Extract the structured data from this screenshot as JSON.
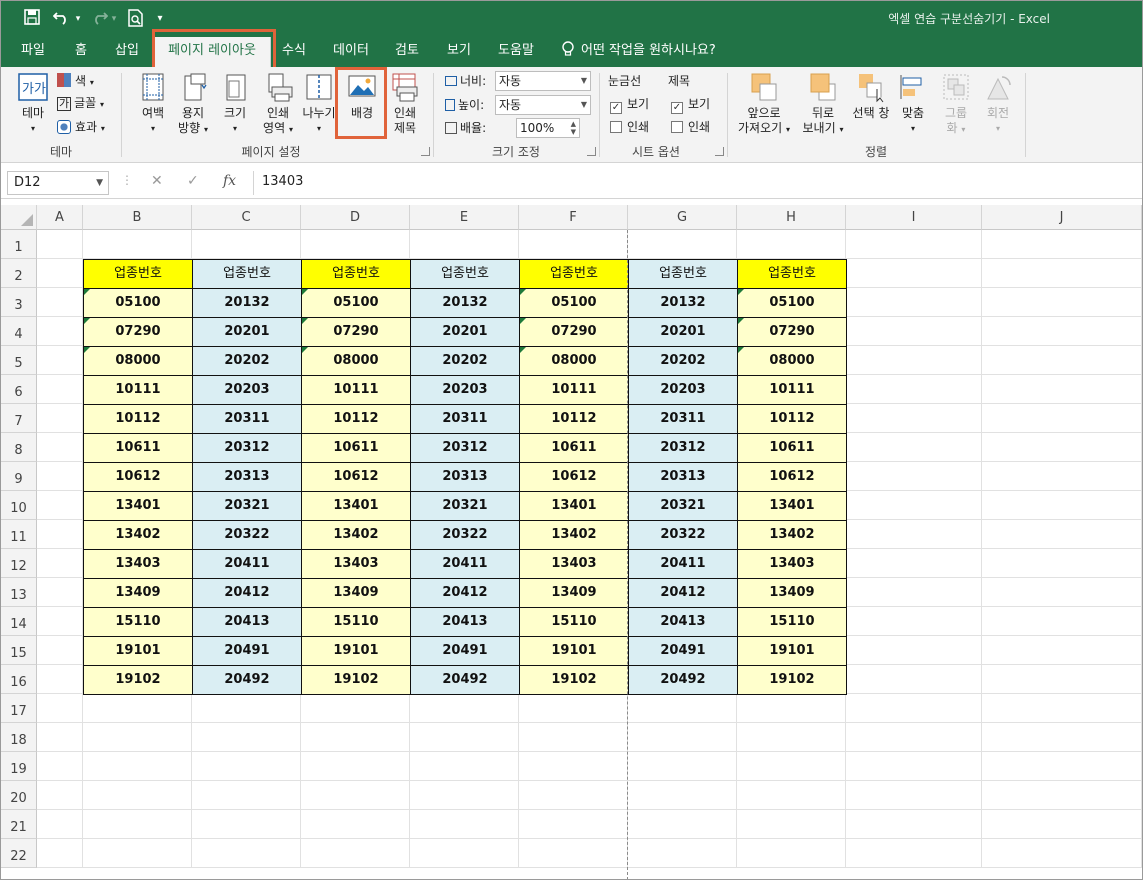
{
  "window": {
    "title": "엑셀 연습 구분선숨기기  -  Excel"
  },
  "tabs": [
    "파일",
    "홈",
    "삽입",
    "페이지 레이아웃",
    "수식",
    "데이터",
    "검토",
    "보기",
    "도움말"
  ],
  "tell_me": "어떤 작업을 원하시나요?",
  "ribbon": {
    "theme": {
      "theme_btn": "테마",
      "color": "색",
      "font": "글꼴",
      "effect": "효과",
      "group": "테마"
    },
    "page_setup": {
      "margins": "여백",
      "orientation_1": "용지",
      "orientation_2": "방향",
      "size": "크기",
      "print_area_1": "인쇄",
      "print_area_2": "영역",
      "breaks": "나누기",
      "background": "배경",
      "print_titles_1": "인쇄",
      "print_titles_2": "제목",
      "group": "페이지 설정"
    },
    "scale": {
      "width_label": "너비:",
      "width_value": "자동",
      "height_label": "높이:",
      "height_value": "자동",
      "scale_label": "배율:",
      "scale_value": "100%",
      "group": "크기 조정"
    },
    "sheet_options": {
      "gridlines": "눈금선",
      "headings": "제목",
      "view": "보기",
      "print": "인쇄",
      "group": "시트 옵션"
    },
    "arrange": {
      "bring_forward_1": "앞으로",
      "bring_forward_2": "가져오기",
      "send_backward_1": "뒤로",
      "send_backward_2": "보내기",
      "selection_pane": "선택 창",
      "align": "맞춤",
      "group_1": "그룹",
      "group_2": "화",
      "rotate": "회전",
      "group": "정렬"
    }
  },
  "formula_bar": {
    "name_box": "D12",
    "cancel": "✕",
    "enter": "✓",
    "fx": "fx",
    "value": "13403"
  },
  "columns": [
    "A",
    "B",
    "C",
    "D",
    "E",
    "F",
    "G",
    "H",
    "I",
    "J"
  ],
  "rows": [
    "1",
    "2",
    "3",
    "4",
    "5",
    "6",
    "7",
    "8",
    "9",
    "10",
    "11",
    "12",
    "13",
    "14",
    "15",
    "16",
    "17",
    "18",
    "19",
    "20",
    "21",
    "22"
  ],
  "header_label": "업종번호",
  "col_b": [
    "05100",
    "07290",
    "08000",
    "10111",
    "10112",
    "10611",
    "10612",
    "13401",
    "13402",
    "13403",
    "13409",
    "15110",
    "19101",
    "19102"
  ],
  "col_c": [
    "20132",
    "20201",
    "20202",
    "20203",
    "20311",
    "20312",
    "20313",
    "20321",
    "20322",
    "20411",
    "20412",
    "20413",
    "20491",
    "20492"
  ],
  "colors": {
    "yellow_header": "#ffff00",
    "yellow_cell": "#ffffcc",
    "blue_cell": "#daeef3",
    "excel_green": "#217346",
    "highlight": "#e0633a"
  }
}
